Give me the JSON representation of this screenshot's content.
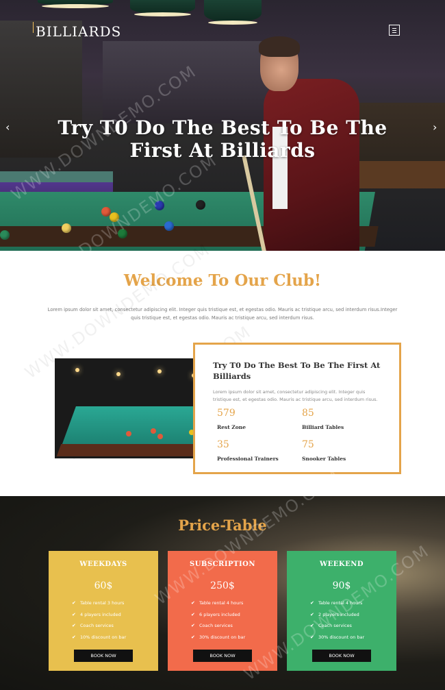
{
  "header": {
    "brand": "BILLIARDS"
  },
  "hero": {
    "title": "Try T0 Do The Best To Be The First At Billiards",
    "prev_label": "‹",
    "next_label": "›"
  },
  "welcome": {
    "title": "Welcome To Our Club!",
    "text": "Lorem ipsum dolor sit amet, consectetur adipiscing elit. Integer quis tristique est, et egestas odio. Mauris ac tristique arcu, sed interdum risus.Integer quis tristique est, et egestas odio. Mauris ac tristique arcu, sed interdum risus."
  },
  "about": {
    "title": "Try T0 Do The Best To Be The First At Billiards",
    "text": "Lorem ipsum dolor sit amet, consectetur adipiscing elit. Integer quis tristique est, et egestas odio. Mauris ac tristique arcu, sed interdum risus.",
    "stats": [
      {
        "value": "579",
        "label": "Rest Zone"
      },
      {
        "value": "85",
        "label": "Billiard Tables"
      },
      {
        "value": "35",
        "label": "Professional Trainers"
      },
      {
        "value": "75",
        "label": "Snooker Tables"
      }
    ]
  },
  "price": {
    "title": "Price-Table",
    "plans": [
      {
        "name": "WEEKDAYS",
        "price": "60$",
        "color": "#e8c04e",
        "features": [
          "Table rental 3 hours",
          "4 players included",
          "Coach services",
          "10% discount on bar"
        ],
        "button": "BOOK NOW"
      },
      {
        "name": "SUBSCRIPTION",
        "price": "250$",
        "color": "#f26b4b",
        "features": [
          "Table rental 4 hours",
          "6 players included",
          "Coach services",
          "30% discount on bar"
        ],
        "button": "BOOK NOW"
      },
      {
        "name": "WEEKEND",
        "price": "90$",
        "color": "#3db06b",
        "features": [
          "Table rental 4 hours",
          "2 players included",
          "Coach services",
          "30% discount on bar"
        ],
        "button": "BOOK NOW"
      }
    ]
  },
  "watermark": "WWW.DOWNDEMO.COM",
  "colors": {
    "accent": "#e4a44a"
  }
}
